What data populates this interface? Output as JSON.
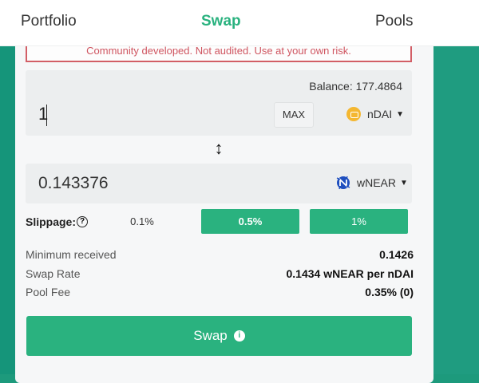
{
  "nav": {
    "portfolio": "Portfolio",
    "swap": "Swap",
    "pools": "Pools"
  },
  "warning": "Community developed. Not audited. Use at your own risk.",
  "from": {
    "balance": "Balance: 177.4864",
    "amount": "1",
    "max_label": "MAX",
    "token": "nDAI"
  },
  "to": {
    "amount": "0.143376",
    "token": "wNEAR"
  },
  "slippage": {
    "label": "Slippage:",
    "options": [
      "0.1%",
      "0.5%",
      "1%"
    ],
    "selected": "0.5%"
  },
  "details": {
    "min_received_label": "Minimum received",
    "min_received_value": "0.1426",
    "swap_rate_label": "Swap Rate",
    "swap_rate_value": "0.1434 wNEAR per nDAI",
    "pool_fee_label": "Pool Fee",
    "pool_fee_value": "0.35% (0)"
  },
  "swap_button": "Swap",
  "colors": {
    "accent": "#2ab27f",
    "background": "#1d9a7c",
    "warning": "#d25e66"
  }
}
